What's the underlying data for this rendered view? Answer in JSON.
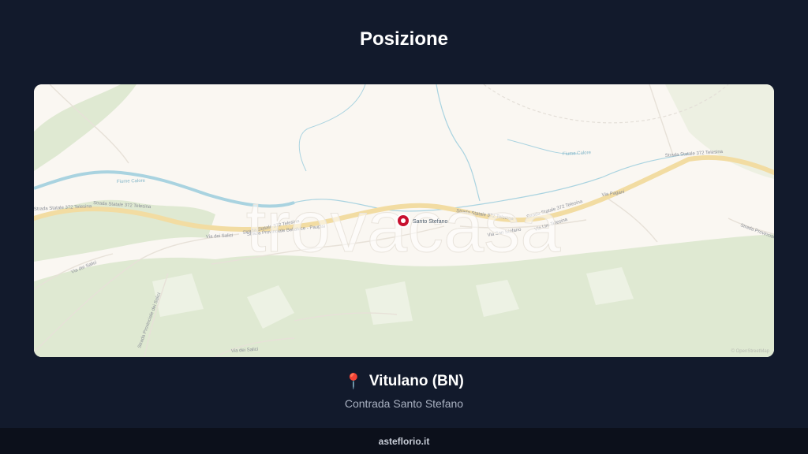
{
  "header": {
    "title": "Posizione"
  },
  "map": {
    "watermark": "trovacasa",
    "marker_label": "Santo Stefano",
    "attribution": "© OpenStreetMap",
    "road_labels": {
      "ss372_a": "Strada Statale 372 Telesina",
      "ss372_b": "Strada Statale 372 Telesina",
      "ss372_c": "Strada Statale 372 Telesina",
      "ss372_d": "Strada Statale 372 Telesina",
      "ss372_e": "Strada Statale 372 Telesina",
      "sp_bellaluce": "Strada Provinciale Bellaluce - Paupisi",
      "via_salici_a": "Via dei Salici",
      "via_salici_b": "Via dei Salici",
      "via_salici_c": "Via dei Salici",
      "via_san_stefano": "Via San Stefano",
      "via_pagani": "Via Pagani",
      "fiume_calore_a": "Fiume Calore",
      "fiume_calore_b": "Fiume Calore",
      "sp_east": "Strada Provinciale",
      "sp_south": "Strada Provinciale dei Salici",
      "via_lim": "Via Lim Telesina"
    },
    "colors": {
      "background": "#faf7f2",
      "vegetation": "#dfe9d2",
      "main_road": "#f2dca2",
      "river": "#a9d3e0",
      "marker": "#c8102e"
    }
  },
  "location": {
    "pin_icon": "📍",
    "name": "Vitulano (BN)",
    "address": "Contrada Santo Stefano"
  },
  "footer": {
    "site": "asteflorio.it"
  }
}
